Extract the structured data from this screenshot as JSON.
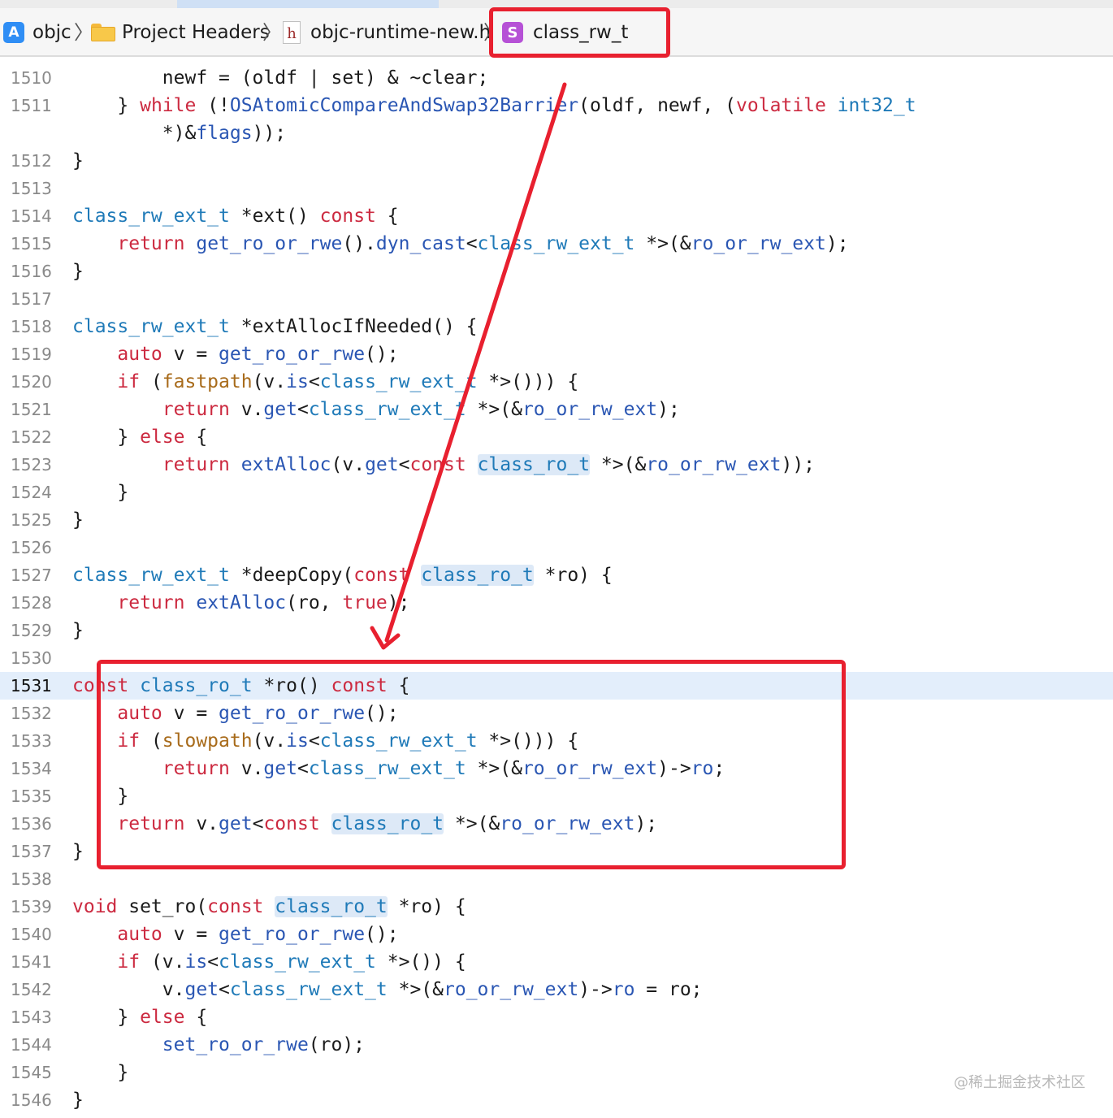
{
  "jump_bar": {
    "items": [
      {
        "label": "objc",
        "icon": "xcode-project-icon"
      },
      {
        "label": "Project Headers",
        "icon": "folder-icon"
      },
      {
        "label": "objc-runtime-new.h",
        "icon": "header-file-icon"
      },
      {
        "label": "class_rw_t",
        "icon": "struct-symbol-icon"
      }
    ],
    "separator": "〉"
  },
  "editor": {
    "current_line": 1531,
    "lines": [
      {
        "n": "1510",
        "segs": [
          [
            "        newf = (oldf | set) & ~clear;",
            ""
          ]
        ]
      },
      {
        "n": "1511",
        "segs": [
          [
            "    } ",
            ""
          ],
          [
            "while",
            "k"
          ],
          [
            " (!",
            ""
          ],
          [
            "OSAtomicCompareAndSwap32Barrier",
            "m"
          ],
          [
            "(oldf, newf, (",
            ""
          ],
          [
            "volatile",
            "k"
          ],
          [
            " ",
            ""
          ],
          [
            "int32_t",
            "t"
          ]
        ]
      },
      {
        "n": "",
        "segs": [
          [
            "        *)&",
            ""
          ],
          [
            "flags",
            "m"
          ],
          [
            "));",
            ""
          ]
        ]
      },
      {
        "n": "1512",
        "segs": [
          [
            "}",
            ""
          ]
        ]
      },
      {
        "n": "1513",
        "segs": []
      },
      {
        "n": "1514",
        "segs": [
          [
            "class_rw_ext_t",
            "t"
          ],
          [
            " *ext() ",
            ""
          ],
          [
            "const",
            "k"
          ],
          [
            " {",
            ""
          ]
        ]
      },
      {
        "n": "1515",
        "segs": [
          [
            "    ",
            ""
          ],
          [
            "return",
            "k"
          ],
          [
            " ",
            ""
          ],
          [
            "get_ro_or_rwe",
            "m"
          ],
          [
            "().",
            ""
          ],
          [
            "dyn_cast",
            "m"
          ],
          [
            "<",
            ""
          ],
          [
            "class_rw_ext_t",
            "t"
          ],
          [
            " *>(&",
            ""
          ],
          [
            "ro_or_rw_ext",
            "m"
          ],
          [
            ");",
            ""
          ]
        ]
      },
      {
        "n": "1516",
        "segs": [
          [
            "}",
            ""
          ]
        ]
      },
      {
        "n": "1517",
        "segs": []
      },
      {
        "n": "1518",
        "segs": [
          [
            "class_rw_ext_t",
            "t"
          ],
          [
            " *extAllocIfNeeded() {",
            ""
          ]
        ]
      },
      {
        "n": "1519",
        "segs": [
          [
            "    ",
            ""
          ],
          [
            "auto",
            "k"
          ],
          [
            " v = ",
            ""
          ],
          [
            "get_ro_or_rwe",
            "m"
          ],
          [
            "();",
            ""
          ]
        ]
      },
      {
        "n": "1520",
        "segs": [
          [
            "    ",
            ""
          ],
          [
            "if",
            "k"
          ],
          [
            " (",
            ""
          ],
          [
            "fastpath",
            "f"
          ],
          [
            "(v.",
            ""
          ],
          [
            "is",
            "m"
          ],
          [
            "<",
            ""
          ],
          [
            "class_rw_ext_t",
            "t"
          ],
          [
            " *>())) {",
            ""
          ]
        ]
      },
      {
        "n": "1521",
        "segs": [
          [
            "        ",
            ""
          ],
          [
            "return",
            "k"
          ],
          [
            " v.",
            ""
          ],
          [
            "get",
            "m"
          ],
          [
            "<",
            ""
          ],
          [
            "class_rw_ext_t",
            "t"
          ],
          [
            " *>(&",
            ""
          ],
          [
            "ro_or_rw_ext",
            "m"
          ],
          [
            ");",
            ""
          ]
        ]
      },
      {
        "n": "1522",
        "segs": [
          [
            "    } ",
            ""
          ],
          [
            "else",
            "k"
          ],
          [
            " {",
            ""
          ]
        ]
      },
      {
        "n": "1523",
        "segs": [
          [
            "        ",
            ""
          ],
          [
            "return",
            "k"
          ],
          [
            " ",
            ""
          ],
          [
            "extAlloc",
            "m"
          ],
          [
            "(v.",
            ""
          ],
          [
            "get",
            "m"
          ],
          [
            "<",
            ""
          ],
          [
            "const",
            "k"
          ],
          [
            " ",
            ""
          ],
          [
            "class_ro_t",
            "t hl"
          ],
          [
            " *>(&",
            ""
          ],
          [
            "ro_or_rw_ext",
            "m"
          ],
          [
            "));",
            ""
          ]
        ]
      },
      {
        "n": "1524",
        "segs": [
          [
            "    }",
            ""
          ]
        ]
      },
      {
        "n": "1525",
        "segs": [
          [
            "}",
            ""
          ]
        ]
      },
      {
        "n": "1526",
        "segs": []
      },
      {
        "n": "1527",
        "segs": [
          [
            "class_rw_ext_t",
            "t"
          ],
          [
            " *deepCopy(",
            ""
          ],
          [
            "const",
            "k"
          ],
          [
            " ",
            ""
          ],
          [
            "class_ro_t",
            "t hl"
          ],
          [
            " *ro) {",
            ""
          ]
        ]
      },
      {
        "n": "1528",
        "segs": [
          [
            "    ",
            ""
          ],
          [
            "return",
            "k"
          ],
          [
            " ",
            ""
          ],
          [
            "extAlloc",
            "m"
          ],
          [
            "(ro, ",
            ""
          ],
          [
            "true",
            "k"
          ],
          [
            ");",
            ""
          ]
        ]
      },
      {
        "n": "1529",
        "segs": [
          [
            "}",
            ""
          ]
        ]
      },
      {
        "n": "1530",
        "segs": []
      },
      {
        "n": "1531",
        "segs": [
          [
            "const",
            "k"
          ],
          [
            " ",
            ""
          ],
          [
            "class_ro_t",
            "t"
          ],
          [
            " *ro() ",
            ""
          ],
          [
            "const",
            "k"
          ],
          [
            " {",
            ""
          ]
        ]
      },
      {
        "n": "1532",
        "segs": [
          [
            "    ",
            ""
          ],
          [
            "auto",
            "k"
          ],
          [
            " v = ",
            ""
          ],
          [
            "get_ro_or_rwe",
            "m"
          ],
          [
            "();",
            ""
          ]
        ]
      },
      {
        "n": "1533",
        "segs": [
          [
            "    ",
            ""
          ],
          [
            "if",
            "k"
          ],
          [
            " (",
            ""
          ],
          [
            "slowpath",
            "f"
          ],
          [
            "(v.",
            ""
          ],
          [
            "is",
            "m"
          ],
          [
            "<",
            ""
          ],
          [
            "class_rw_ext_t",
            "t"
          ],
          [
            " *>())) {",
            ""
          ]
        ]
      },
      {
        "n": "1534",
        "segs": [
          [
            "        ",
            ""
          ],
          [
            "return",
            "k"
          ],
          [
            " v.",
            ""
          ],
          [
            "get",
            "m"
          ],
          [
            "<",
            ""
          ],
          [
            "class_rw_ext_t",
            "t"
          ],
          [
            " *>(&",
            ""
          ],
          [
            "ro_or_rw_ext",
            "m"
          ],
          [
            ")->",
            ""
          ],
          [
            "ro",
            "m"
          ],
          [
            ";",
            ""
          ]
        ]
      },
      {
        "n": "1535",
        "segs": [
          [
            "    }",
            ""
          ]
        ]
      },
      {
        "n": "1536",
        "segs": [
          [
            "    ",
            ""
          ],
          [
            "return",
            "k"
          ],
          [
            " v.",
            ""
          ],
          [
            "get",
            "m"
          ],
          [
            "<",
            ""
          ],
          [
            "const",
            "k"
          ],
          [
            " ",
            ""
          ],
          [
            "class_ro_t",
            "t hl"
          ],
          [
            " *>(&",
            ""
          ],
          [
            "ro_or_rw_ext",
            "m"
          ],
          [
            ");",
            ""
          ]
        ]
      },
      {
        "n": "1537",
        "segs": [
          [
            "}",
            ""
          ]
        ]
      },
      {
        "n": "1538",
        "segs": []
      },
      {
        "n": "1539",
        "segs": [
          [
            "void",
            "k"
          ],
          [
            " set_ro(",
            ""
          ],
          [
            "const",
            "k"
          ],
          [
            " ",
            ""
          ],
          [
            "class_ro_t",
            "t hl"
          ],
          [
            " *ro) {",
            ""
          ]
        ]
      },
      {
        "n": "1540",
        "segs": [
          [
            "    ",
            ""
          ],
          [
            "auto",
            "k"
          ],
          [
            " v = ",
            ""
          ],
          [
            "get_ro_or_rwe",
            "m"
          ],
          [
            "();",
            ""
          ]
        ]
      },
      {
        "n": "1541",
        "segs": [
          [
            "    ",
            ""
          ],
          [
            "if",
            "k"
          ],
          [
            " (v.",
            ""
          ],
          [
            "is",
            "m"
          ],
          [
            "<",
            ""
          ],
          [
            "class_rw_ext_t",
            "t"
          ],
          [
            " *>()) {",
            ""
          ]
        ]
      },
      {
        "n": "1542",
        "segs": [
          [
            "        v.",
            ""
          ],
          [
            "get",
            "m"
          ],
          [
            "<",
            ""
          ],
          [
            "class_rw_ext_t",
            "t"
          ],
          [
            " *>(&",
            ""
          ],
          [
            "ro_or_rw_ext",
            "m"
          ],
          [
            ")->",
            ""
          ],
          [
            "ro",
            "m"
          ],
          [
            " = ro;",
            ""
          ]
        ]
      },
      {
        "n": "1543",
        "segs": [
          [
            "    } ",
            ""
          ],
          [
            "else",
            "k"
          ],
          [
            " {",
            ""
          ]
        ]
      },
      {
        "n": "1544",
        "segs": [
          [
            "        ",
            ""
          ],
          [
            "set_ro_or_rwe",
            "m"
          ],
          [
            "(ro);",
            ""
          ]
        ]
      },
      {
        "n": "1545",
        "segs": [
          [
            "    }",
            ""
          ]
        ]
      },
      {
        "n": "1546",
        "segs": [
          [
            "}",
            ""
          ]
        ]
      }
    ]
  },
  "annotations": {
    "color": "#e8202f"
  },
  "watermark": "@稀土掘金技术社区",
  "colors": {
    "keyword": "#cc2a40",
    "type": "#1f7ab8",
    "member": "#2a56b3",
    "macro": "#a86b1b",
    "current_line_bg": "#e3eefb"
  }
}
